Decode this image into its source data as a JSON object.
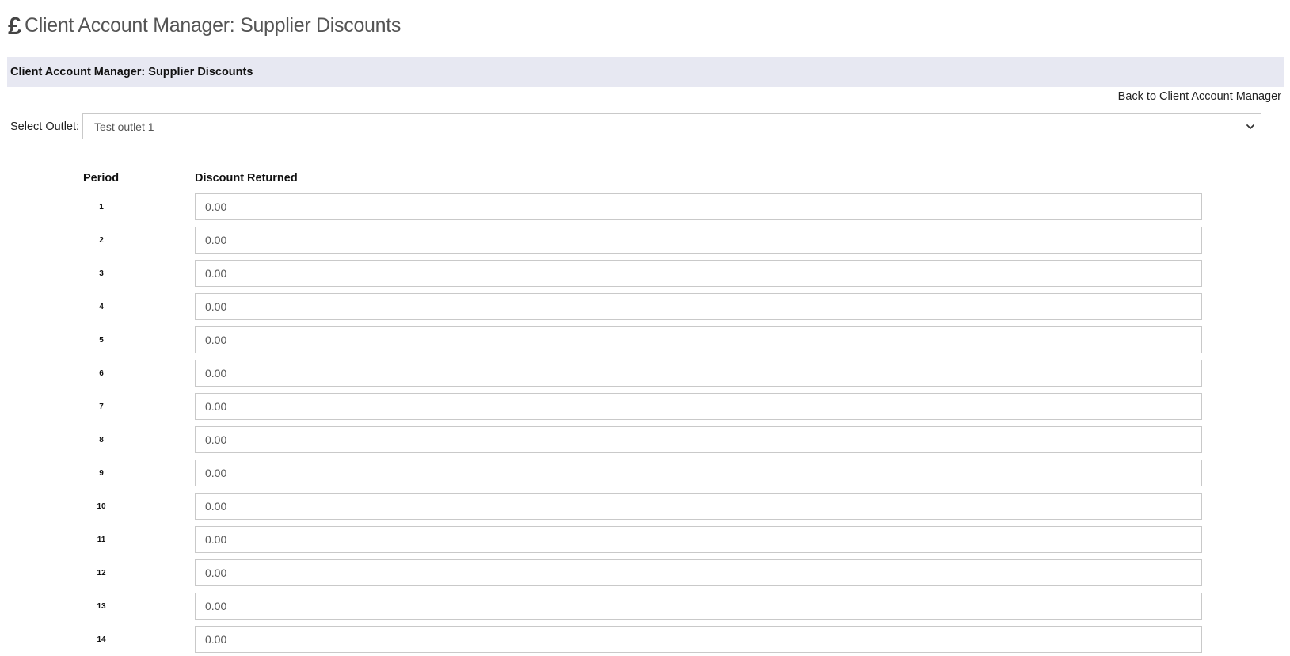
{
  "page": {
    "title": "Client Account Manager: Supplier Discounts",
    "title_icon": "pound-sterling-icon",
    "title_icon_glyph": "£"
  },
  "panel": {
    "heading": "Client Account Manager: Supplier Discounts"
  },
  "back_link": {
    "label": "Back to Client Account Manager"
  },
  "outlet": {
    "label": "Select Outlet:",
    "selected": "Test outlet 1"
  },
  "table": {
    "headers": {
      "period": "Period",
      "discount": "Discount Returned"
    },
    "rows": [
      {
        "period": "1",
        "discount": "0.00"
      },
      {
        "period": "2",
        "discount": "0.00"
      },
      {
        "period": "3",
        "discount": "0.00"
      },
      {
        "period": "4",
        "discount": "0.00"
      },
      {
        "period": "5",
        "discount": "0.00"
      },
      {
        "period": "6",
        "discount": "0.00"
      },
      {
        "period": "7",
        "discount": "0.00"
      },
      {
        "period": "8",
        "discount": "0.00"
      },
      {
        "period": "9",
        "discount": "0.00"
      },
      {
        "period": "10",
        "discount": "0.00"
      },
      {
        "period": "11",
        "discount": "0.00"
      },
      {
        "period": "12",
        "discount": "0.00"
      },
      {
        "period": "13",
        "discount": "0.00"
      },
      {
        "period": "14",
        "discount": "0.00"
      }
    ]
  },
  "colors": {
    "panel_bg": "#e7e8f2",
    "border": "#c9c9c9",
    "title_text": "#555555"
  }
}
